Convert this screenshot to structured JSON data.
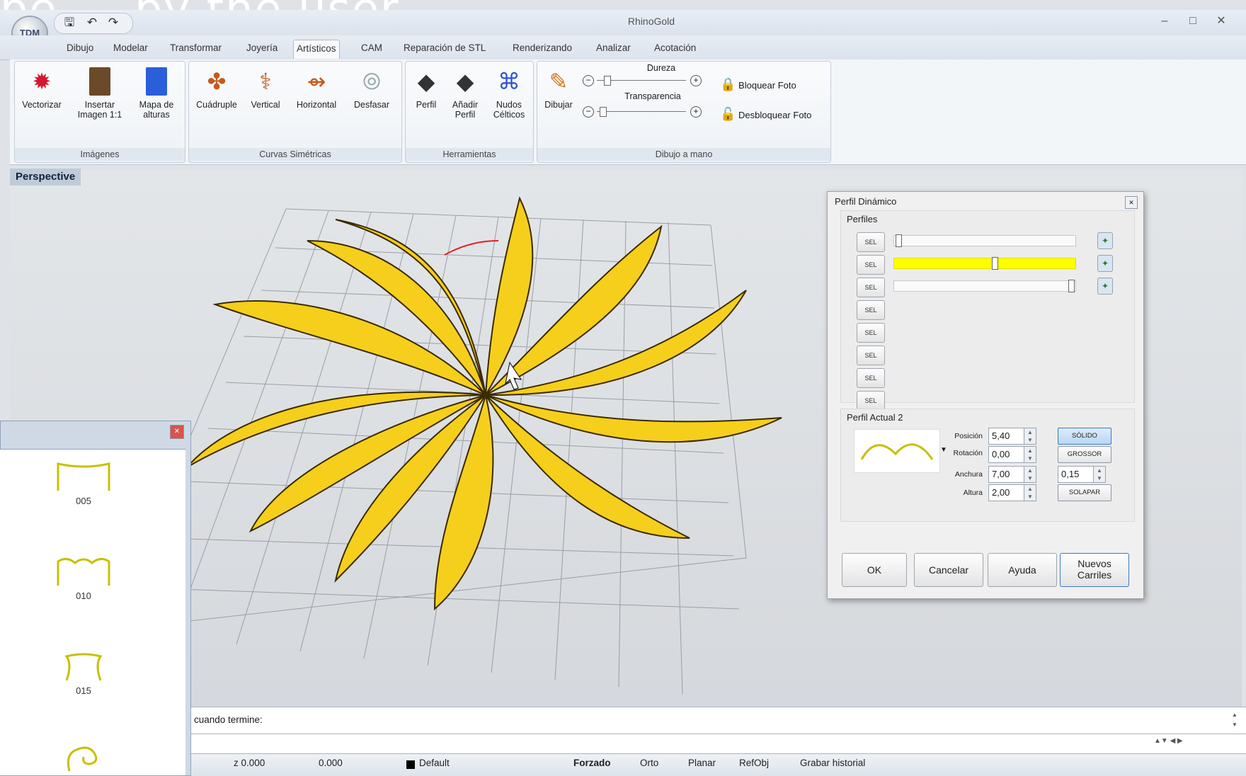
{
  "slide_overlay_text": "be ... by the user",
  "window": {
    "title": "RhinoGold",
    "logo": "TDM",
    "controls": [
      "–",
      "□",
      "✕"
    ],
    "quick_access": [
      "save-icon",
      "undo-icon",
      "redo-icon"
    ]
  },
  "tabs": [
    "Dibujo",
    "Modelar",
    "Transformar",
    "Joyería",
    "Artísticos",
    "CAM",
    "Reparación de STL",
    "Renderizando",
    "Analizar",
    "Acotación"
  ],
  "active_tab": "Artísticos",
  "ribbon": {
    "groups": [
      {
        "label": "Imágenes",
        "buttons": [
          {
            "label": "Vectorizar",
            "icon": "vectorize-icon"
          },
          {
            "label": "Insertar Imagen 1:1",
            "icon": "insert-image-icon"
          },
          {
            "label": "Mapa de alturas",
            "icon": "heightmap-icon"
          }
        ]
      },
      {
        "label": "Curvas Simétricas",
        "buttons": [
          {
            "label": "Cuádruple",
            "icon": "quadruple-icon"
          },
          {
            "label": "Vertical",
            "icon": "vertical-symmetry-icon"
          },
          {
            "label": "Horizontal",
            "icon": "horizontal-symmetry-icon"
          },
          {
            "label": "Desfasar",
            "icon": "offset-icon"
          }
        ]
      },
      {
        "label": "Herramientas",
        "buttons": [
          {
            "label": "Perfil",
            "icon": "profile-icon"
          },
          {
            "label": "Añadir Perfil",
            "icon": "add-profile-icon"
          },
          {
            "label": "Nudos Célticos",
            "icon": "celtic-knot-icon"
          }
        ]
      },
      {
        "label": "Dibujo a mano",
        "buttons": [
          {
            "label": "Dibujar",
            "icon": "pencil-icon"
          }
        ],
        "sliders": [
          {
            "label": "Dureza",
            "value": 0.12
          },
          {
            "label": "Transparencia",
            "value": 0.08
          }
        ],
        "lock_label": "Bloquear Foto",
        "unlock_label": "Desbloquear Foto"
      }
    ]
  },
  "viewport": {
    "label": "Perspective"
  },
  "dialog": {
    "title": "Perfil Dinámico",
    "close": "✕",
    "profiles_label": "Perfiles",
    "sel_label": "SEL",
    "sel_count": 8,
    "sliders": [
      {
        "value": 0.0
      },
      {
        "value": 0.55,
        "highlighted": true
      },
      {
        "value": 1.0
      }
    ],
    "current_profile_label": "Perfil Actual 2",
    "fields": {
      "posicion_label": "Posición",
      "posicion": "5,40",
      "rotacion_label": "Rotación",
      "rotacion": "0,00",
      "anchura_label": "Anchura",
      "anchura": "7,00",
      "altura_label": "Altura",
      "altura": "2,00",
      "grosor_value": "0,15"
    },
    "side_buttons": {
      "solido": "SÓLIDO",
      "grosor": "GROSSOR",
      "solapar": "SOLAPAR"
    },
    "buttons": {
      "ok": "OK",
      "cancel": "Cancelar",
      "help": "Ayuda",
      "new_rails": "Nuevos Carriles"
    }
  },
  "left_panel": {
    "profiles": [
      "005",
      "010",
      "015"
    ]
  },
  "command_line": {
    "prompt": "cuando termine:"
  },
  "status_bar": {
    "z": "z 0.000",
    "coord": "0.000",
    "layer": "Default",
    "toggles": [
      "Forzado",
      "Orto",
      "Planar",
      "RefObj",
      "Grabar historial"
    ]
  },
  "colors": {
    "accent_yellow": "#f5cf1c",
    "highlight_yellow": "#ffff00",
    "grid": "#9a9fa6"
  }
}
